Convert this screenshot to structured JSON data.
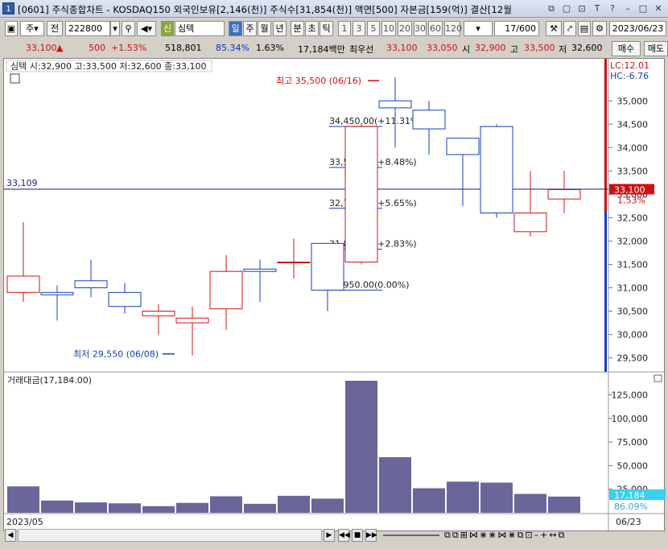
{
  "window": {
    "number": "1",
    "title": "[0601] 주식종합차트 - KOSDAQ150 외국인보유[2,146(천)] 주식수[31,854(천)] 액면[500] 자본금[159(억)] 결산[12월"
  },
  "toolbar": {
    "mode": "주",
    "mode2": "전",
    "code": "222800",
    "badge": "신",
    "name": "심텍",
    "periods": [
      "일",
      "주",
      "월",
      "년",
      "분",
      "초",
      "틱"
    ],
    "intervals": [
      "1",
      "3",
      "5",
      "10",
      "20",
      "30",
      "60",
      "120"
    ],
    "count": "17",
    "count_total": "/600",
    "date": "2023/06/23"
  },
  "quote": {
    "price": "33,100",
    "arrow": "▲",
    "change": "500",
    "change_pct": "+1.53%",
    "volume": "518,801",
    "ratio": "85.34%",
    "turnover": "1.63%",
    "amount": "17,184백만",
    "best_label": "최우선",
    "ask": "33,100",
    "bid": "33,050",
    "open_label": "시",
    "open": "32,900",
    "high_label": "고",
    "high": "33,500",
    "low_label": "저",
    "low": "32,600",
    "buy_btn": "매수",
    "sell_btn": "매도"
  },
  "price_panel": {
    "legend": "심텍 시:32,900 고:33,500 저:32,600 종:33,100",
    "lc": "LC:12.01",
    "hc": "HC:-6.76",
    "hline_label": "33,109",
    "cur_price": "33,100",
    "cur_pct": "1.53%",
    "high_note": "최고 35,500 (06/16)",
    "low_note": "최저 29,550 (06/08)",
    "fib_labels": [
      "34,450.00(+11.31%)",
      "33,575.00(+8.48%)",
      "32,700.00(+5.65%)",
      "31,825.00(+2.83%)",
      "30,950.00(0.00%)"
    ]
  },
  "volume_panel": {
    "legend": "거래대금(17,184.00)",
    "cur_value": "17,184",
    "cur_pct": "86.09%"
  },
  "axis": {
    "start_date": "2023/05",
    "end_date": "06/23"
  },
  "colors": {
    "up": "#d01010",
    "down": "#1040c0",
    "volume": "#6a6699",
    "hline": "#1a1a80"
  },
  "chart_data": [
    {
      "type": "candlestick",
      "ylim": [
        29200,
        35900
      ],
      "yticks": [
        29500,
        30000,
        30500,
        31000,
        31500,
        32000,
        32500,
        33000,
        33500,
        34000,
        34500,
        35000
      ],
      "candles": [
        {
          "open": 30900,
          "high": 32400,
          "low": 30700,
          "close": 31250
        },
        {
          "open": 30900,
          "high": 31050,
          "low": 30300,
          "close": 30850
        },
        {
          "open": 31150,
          "high": 31600,
          "low": 30800,
          "close": 31000
        },
        {
          "open": 30900,
          "high": 31100,
          "low": 30450,
          "close": 30600
        },
        {
          "open": 30400,
          "high": 30650,
          "low": 30000,
          "close": 30500
        },
        {
          "open": 30250,
          "high": 30600,
          "low": 29550,
          "close": 30350
        },
        {
          "open": 30550,
          "high": 31700,
          "low": 30100,
          "close": 31350
        },
        {
          "open": 31400,
          "high": 31600,
          "low": 30700,
          "close": 31350
        },
        {
          "open": 31550,
          "high": 32050,
          "low": 31200,
          "close": 31550
        },
        {
          "open": 31950,
          "high": 31950,
          "low": 30500,
          "close": 30950
        },
        {
          "open": 31550,
          "high": 34500,
          "low": 31500,
          "close": 34450
        },
        {
          "open": 35000,
          "high": 35500,
          "low": 34000,
          "close": 34850
        },
        {
          "open": 34800,
          "high": 35000,
          "low": 33850,
          "close": 34400
        },
        {
          "open": 34200,
          "high": 34200,
          "low": 32750,
          "close": 33850
        },
        {
          "open": 34450,
          "high": 34500,
          "low": 32500,
          "close": 32600
        },
        {
          "open": 32200,
          "high": 33500,
          "low": 32100,
          "close": 32600
        },
        {
          "open": 32900,
          "high": 33500,
          "low": 32600,
          "close": 33100
        }
      ],
      "fib_levels": [
        34450,
        33575,
        32700,
        31825,
        30950
      ]
    },
    {
      "type": "bar",
      "title": "거래대금",
      "ylim": [
        0,
        140000
      ],
      "yticks": [
        25000,
        50000,
        75000,
        100000,
        125000
      ],
      "values": [
        28000,
        13000,
        11000,
        10000,
        7000,
        10500,
        17500,
        9500,
        18000,
        15000,
        140000,
        59000,
        26000,
        33000,
        32000,
        20000,
        17184
      ]
    }
  ]
}
